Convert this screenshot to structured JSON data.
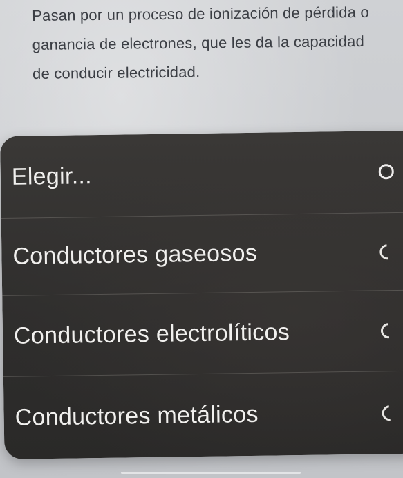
{
  "question": {
    "text": "Pasan por un proceso de ionización de pérdida o ganancia de electrones, que les da la capacidad de conducir electricidad."
  },
  "select": {
    "options": [
      {
        "label": "Elegir...",
        "selected": true
      },
      {
        "label": "Conductores gaseosos",
        "selected": false
      },
      {
        "label": "Conductores electrolíticos",
        "selected": false
      },
      {
        "label": "Conductores metálicos",
        "selected": false
      }
    ]
  },
  "colors": {
    "menu_background": "#2f2e2d",
    "menu_text": "#f1f0ee",
    "page_background": "#c6c8cc",
    "question_text": "#3b3e44"
  }
}
